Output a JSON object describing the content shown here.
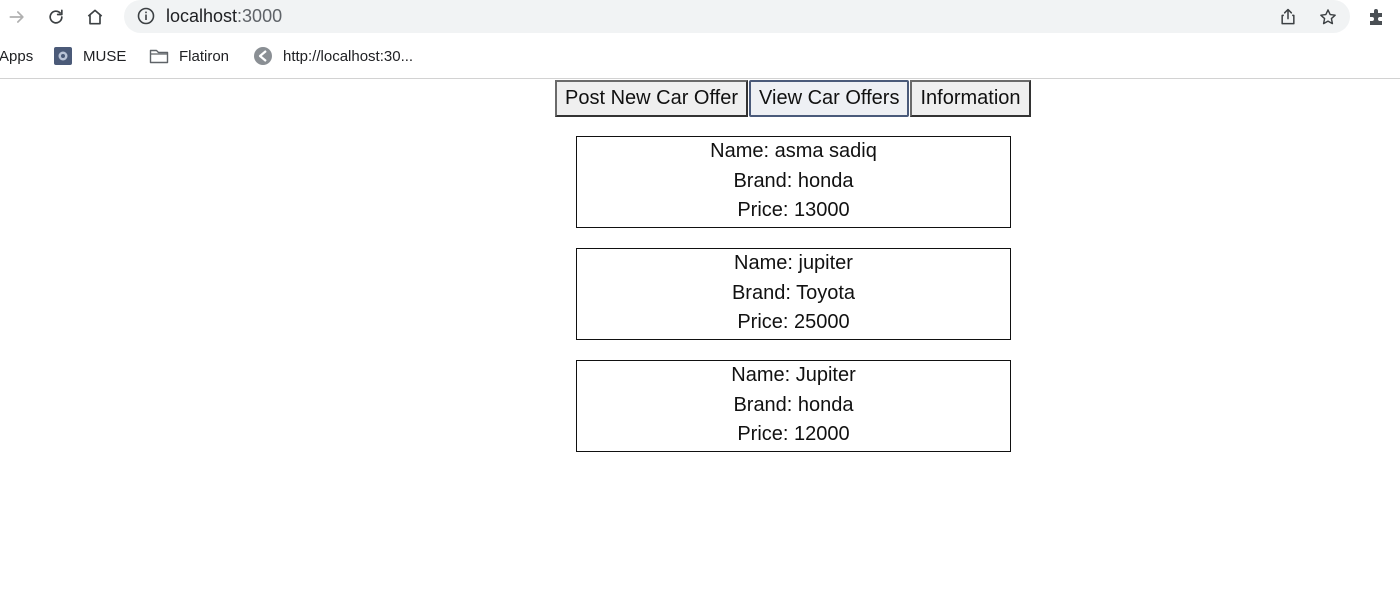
{
  "browser": {
    "url_host": "localhost",
    "url_port": ":3000"
  },
  "bookmarks": [
    {
      "label": "Apps",
      "icon": "apps-grid-icon"
    },
    {
      "label": "MUSE",
      "icon": "muse-favicon-icon"
    },
    {
      "label": "Flatiron",
      "icon": "folder-icon"
    },
    {
      "label": "http://localhost:30...",
      "icon": "globe-favicon-icon"
    }
  ],
  "nav": {
    "post_label": "Post New Car Offer",
    "view_label": "View Car Offers",
    "info_label": "Information",
    "active": "View Car Offers"
  },
  "offers": [
    {
      "name": "Name: asma sadiq",
      "brand": "Brand: honda",
      "price": "Price: 13000"
    },
    {
      "name": "Name: jupiter",
      "brand": "Brand: Toyota",
      "price": "Price: 25000"
    },
    {
      "name": "Name: Jupiter",
      "brand": "Brand: honda",
      "price": "Price: 12000"
    }
  ]
}
